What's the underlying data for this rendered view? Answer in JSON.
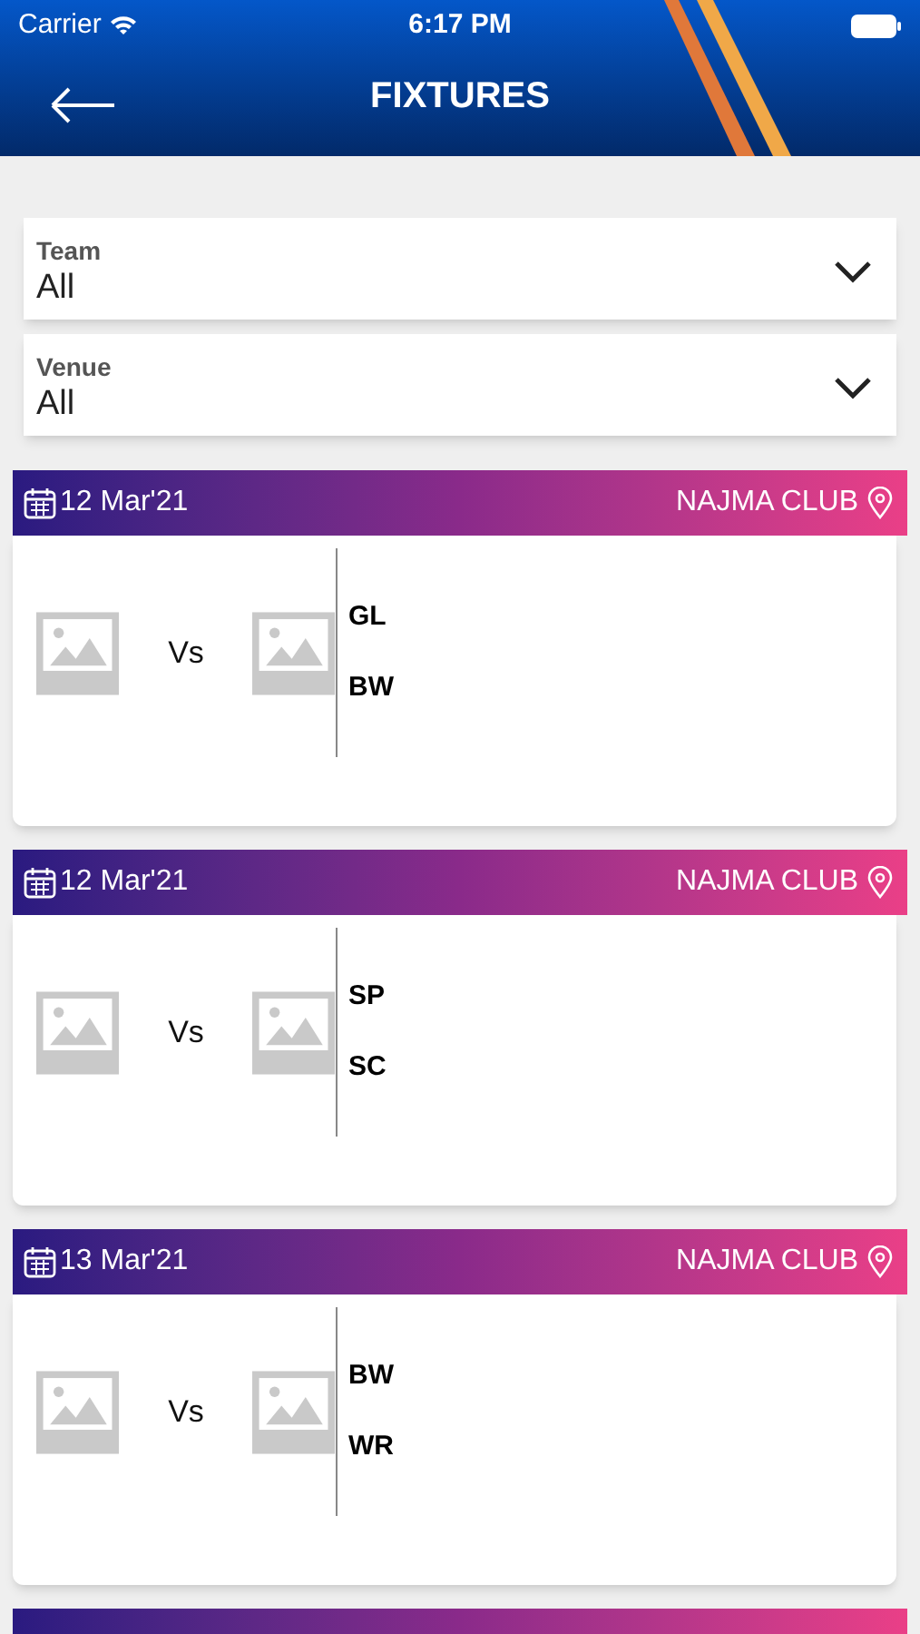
{
  "status_bar": {
    "carrier": "Carrier",
    "time": "6:17 PM"
  },
  "nav": {
    "title": "FIXTURES"
  },
  "filters": [
    {
      "label": "Team",
      "value": "All"
    },
    {
      "label": "Venue",
      "value": "All"
    }
  ],
  "fixtures": [
    {
      "date": "12 Mar'21",
      "venue": "NAJMA CLUB",
      "vs": "Vs",
      "team_1": "GL",
      "team_2": "BW"
    },
    {
      "date": "12 Mar'21",
      "venue": "NAJMA CLUB",
      "vs": "Vs",
      "team_1": "SP",
      "team_2": "SC"
    },
    {
      "date": "13 Mar'21",
      "venue": "NAJMA CLUB",
      "vs": "Vs",
      "team_1": "BW",
      "team_2": "WR"
    }
  ]
}
